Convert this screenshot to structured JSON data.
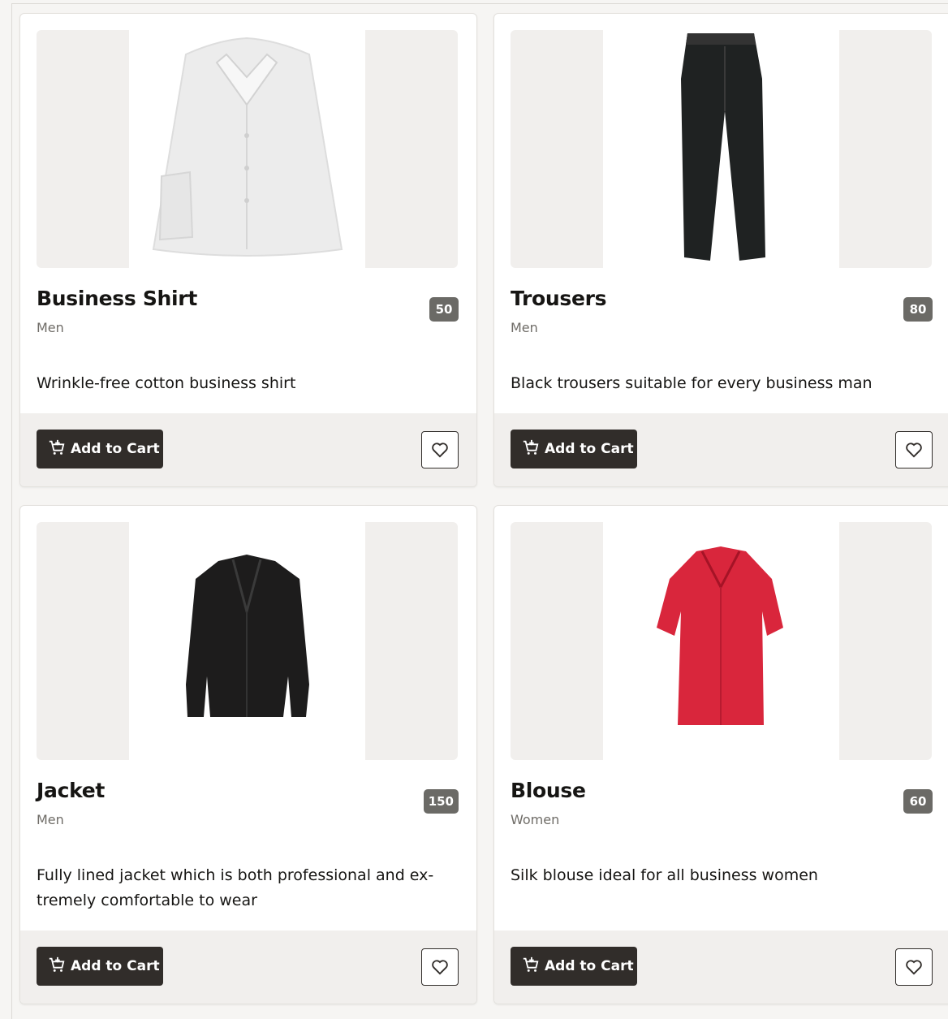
{
  "products": [
    {
      "name": "Business Shirt",
      "category": "Men",
      "price_badge": "50",
      "description": "Wrinkle-free cotton business shirt",
      "image_icon": "shirt-image",
      "add_to_cart_label": "Add to Cart"
    },
    {
      "name": "Trousers",
      "category": "Men",
      "price_badge": "80",
      "description": "Black trousers suitable for every business man",
      "image_icon": "trousers-image",
      "add_to_cart_label": "Add to Cart"
    },
    {
      "name": "Jacket",
      "category": "Men",
      "price_badge": "150",
      "description": "Fully lined jacket which is both professional and ex-tremely comfortable to wear",
      "image_icon": "jacket-image",
      "add_to_cart_label": "Add to Cart"
    },
    {
      "name": "Blouse",
      "category": "Women",
      "price_badge": "60",
      "description": "Silk blouse ideal for all business women",
      "image_icon": "blouse-image",
      "add_to_cart_label": "Add to Cart"
    }
  ],
  "icons": {
    "cart": "cart-icon",
    "favorite": "heart-icon"
  },
  "colors": {
    "button_bg": "#312d2a",
    "badge_bg": "#6b6a66",
    "card_footer": "#f1efed",
    "blouse": "#d9263c"
  }
}
